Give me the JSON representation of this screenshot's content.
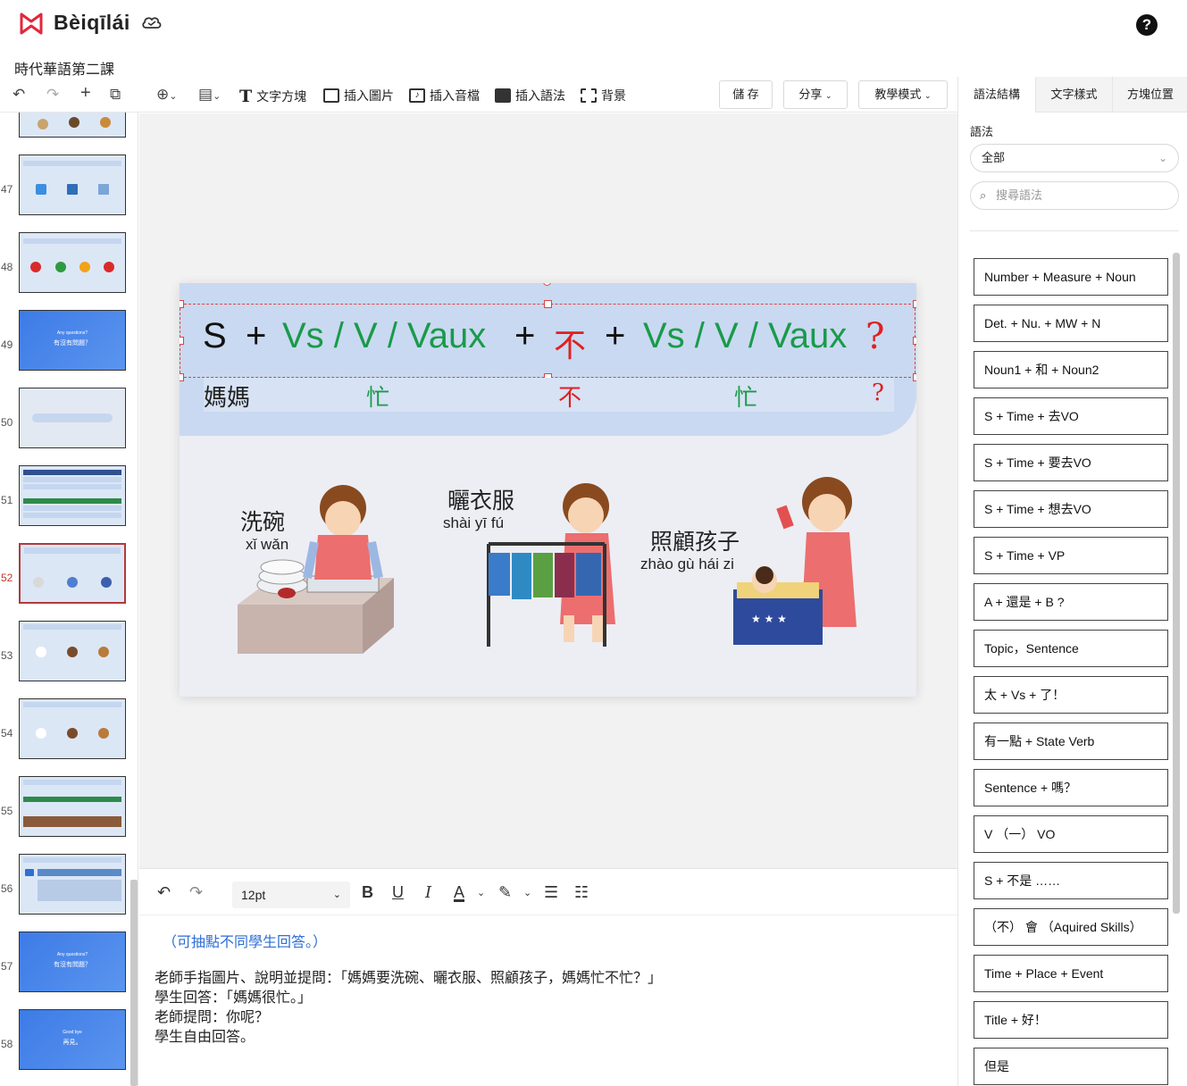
{
  "app": {
    "name": "Bèiqīlái",
    "doc_title": "時代華語第二課"
  },
  "toolbar": {
    "text_box": "文字方塊",
    "insert_image": "插入圖片",
    "insert_audio": "插入音檔",
    "insert_grammar": "插入語法",
    "background": "背景",
    "save": "儲 存",
    "share": "分享",
    "teach_mode": "教學模式"
  },
  "thumbnails": [
    {
      "num": "47"
    },
    {
      "num": "48"
    },
    {
      "num": "49"
    },
    {
      "num": "50"
    },
    {
      "num": "51"
    },
    {
      "num": "52"
    },
    {
      "num": "53"
    },
    {
      "num": "54"
    },
    {
      "num": "55"
    },
    {
      "num": "56"
    },
    {
      "num": "57"
    },
    {
      "num": "58"
    }
  ],
  "slide": {
    "formula": {
      "s": "S",
      "plus1": "+",
      "part1": "Vs / V / Vaux",
      "plus2": "+",
      "neg": "不",
      "plus3": "+",
      "part2": "Vs / V / Vaux",
      "q": "?"
    },
    "example": {
      "subject": "媽媽",
      "v1": "忙",
      "neg": "不",
      "v2": "忙",
      "q": "?"
    },
    "captions": [
      {
        "zh": "洗碗",
        "py": "xǐ  wǎn"
      },
      {
        "zh": "曬衣服",
        "py": "shài yī   fú"
      },
      {
        "zh": "照顧孩子",
        "py": "zhào gù hái   zi"
      }
    ]
  },
  "editor": {
    "font_size": "12pt",
    "hint": "（可抽點不同學生回答。）",
    "lines": [
      "老師手指圖片、說明並提問：「媽媽要洗碗、曬衣服、照顧孩子，媽媽忙不忙？」",
      "學生回答：「媽媽很忙。」",
      "老師提問：你呢？",
      "學生自由回答。"
    ]
  },
  "right_panel": {
    "tabs": [
      "語法結構",
      "文字樣式",
      "方塊位置"
    ],
    "grammar_label": "語法",
    "filter_value": "全部",
    "search_placeholder": "搜尋語法",
    "items": [
      "Number + Measure + Noun",
      "Det. + Nu. + MW + N",
      "Noun1 + 和 + Noun2",
      "S + Time + 去VO",
      "S + Time + 要去VO",
      "S + Time + 想去VO",
      "S + Time + VP",
      "A + 還是 + B ?",
      "Topic，Sentence",
      "太 + Vs + 了！",
      "有一點 + State Verb",
      "Sentence + 嗎？",
      "V （一） VO",
      "S + 不是 ……",
      "（不） 會 （Aquired Skills）",
      "Time + Place + Event",
      "Title + 好！",
      "但是"
    ]
  },
  "colors": {
    "green": "#1a9a4a",
    "red": "#e02020",
    "accent": "#2d6ed6",
    "logo": "#e0283b"
  }
}
